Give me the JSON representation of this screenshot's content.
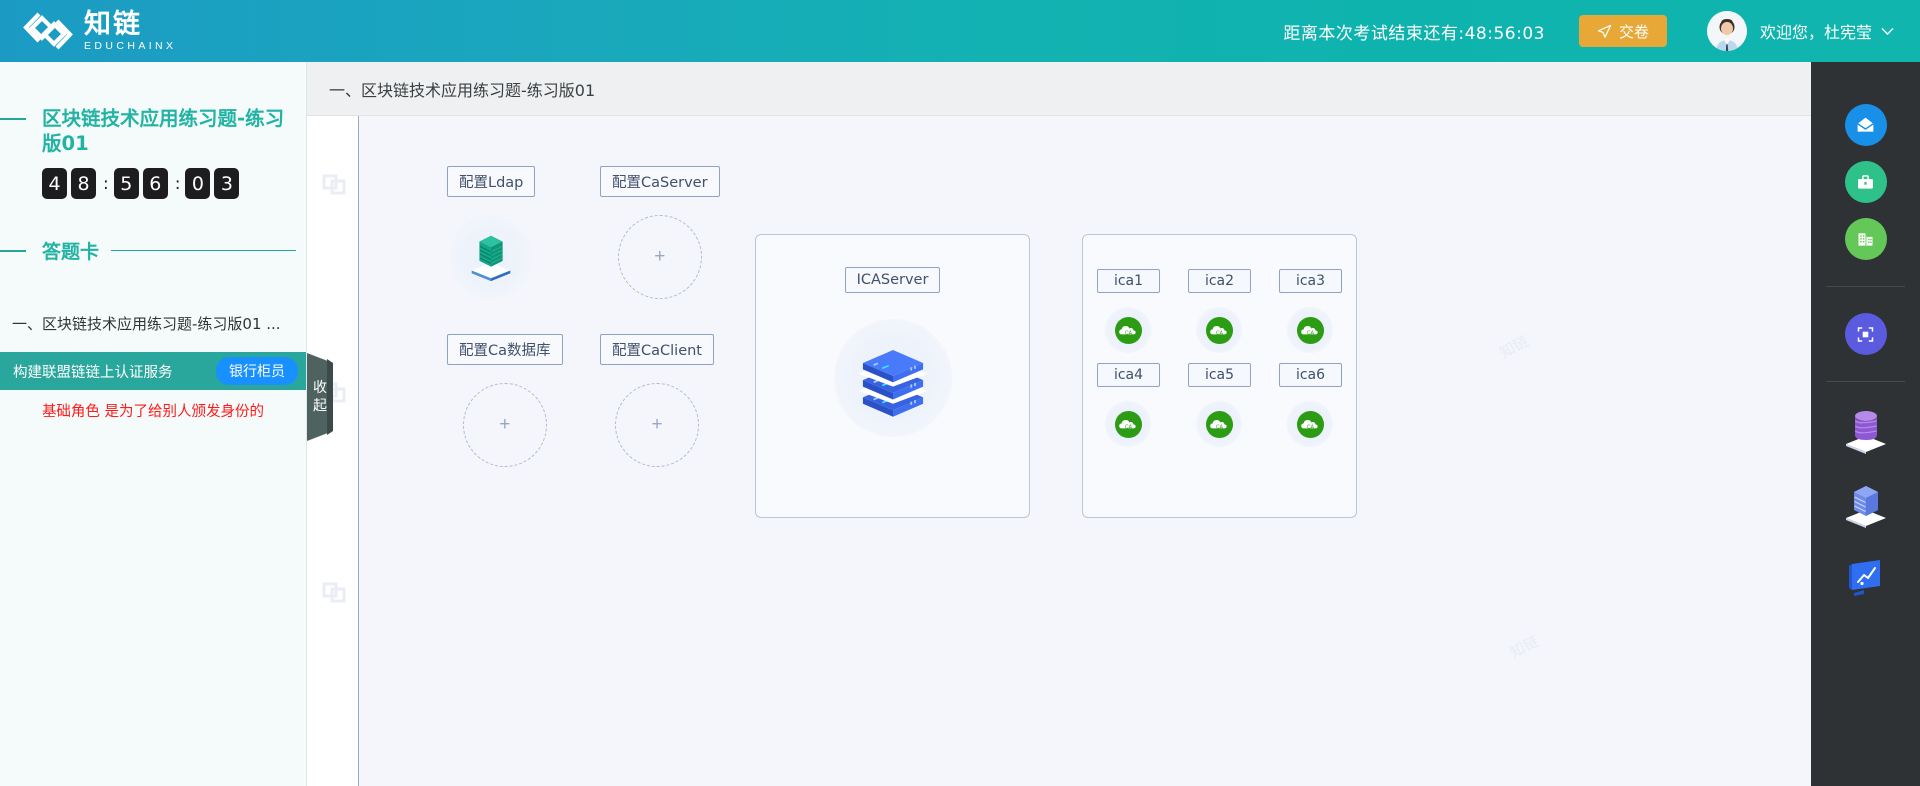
{
  "header": {
    "logo_cn": "知链",
    "logo_en": "EDUCHAINX",
    "countdown_text": "距离本次考试结束还有:48:56:03",
    "submit_label": "交卷",
    "greeting": "欢迎您，杜宪莹",
    "accent_gradient_start": "#1b9bc4",
    "accent_gradient_end": "#10b5ae",
    "submit_color": "#e8a838"
  },
  "sidebar": {
    "exam_title": "区块链技术应用练习题-练习版01",
    "countdown_digits": [
      "4",
      "8",
      "5",
      "6",
      "0",
      "3"
    ],
    "countdown_separator": ":",
    "answer_card_title": "答题卡",
    "question_group": "一、区块链技术应用练习题-练习版01 ...",
    "active_item": {
      "label": "构建联盟链链上认证服务",
      "badge": "银行柜员",
      "badge_color": "#1890ff",
      "bg_color": "#2aa79c"
    },
    "note": "基础角色 是为了给别人颁发身份的",
    "note_color": "#ff1a1a",
    "accent_color": "#23b3a4"
  },
  "collapse_handle": {
    "label_chars": [
      "收",
      "起"
    ]
  },
  "main": {
    "breadcrumb": "一、区块链技术应用练习题-练习版01"
  },
  "canvas": {
    "watermark": "知链",
    "nodes": [
      {
        "label": "配置Ldap",
        "icon": "layers-green-icon",
        "state": "filled"
      },
      {
        "label": "配置CaServer",
        "icon": "plus-icon",
        "state": "empty",
        "placeholder": "+"
      },
      {
        "label": "配置Ca数据库",
        "icon": "plus-icon",
        "state": "empty",
        "placeholder": "+"
      },
      {
        "label": "配置CaClient",
        "icon": "plus-icon",
        "state": "empty",
        "placeholder": "+"
      }
    ],
    "ica_server_panel": {
      "label": "ICAServer",
      "icon": "server-stack-blue-icon"
    },
    "ica_panel": {
      "items": [
        {
          "label": "ica1",
          "icon": "cloud-ca-green-icon"
        },
        {
          "label": "ica2",
          "icon": "cloud-ca-green-icon"
        },
        {
          "label": "ica3",
          "icon": "cloud-ca-green-icon"
        },
        {
          "label": "ica4",
          "icon": "cloud-ca-green-icon"
        },
        {
          "label": "ica5",
          "icon": "cloud-ca-green-icon"
        },
        {
          "label": "ica6",
          "icon": "cloud-ca-green-icon"
        }
      ]
    }
  },
  "right_rail": {
    "items": [
      {
        "icon": "envelope-icon",
        "color": "#1890e8"
      },
      {
        "icon": "briefcase-icon",
        "color": "#2ec28a"
      },
      {
        "icon": "building-icon",
        "color": "#63c857"
      },
      {
        "icon": "scan-frame-icon",
        "color": "#5b5be0"
      },
      {
        "icon": "database-cylinder-icon",
        "color": "#9b6ddb"
      },
      {
        "icon": "cube-stack-icon",
        "color": "#7b93ea"
      },
      {
        "icon": "monitor-chart-icon",
        "color": "#2563eb"
      }
    ]
  }
}
